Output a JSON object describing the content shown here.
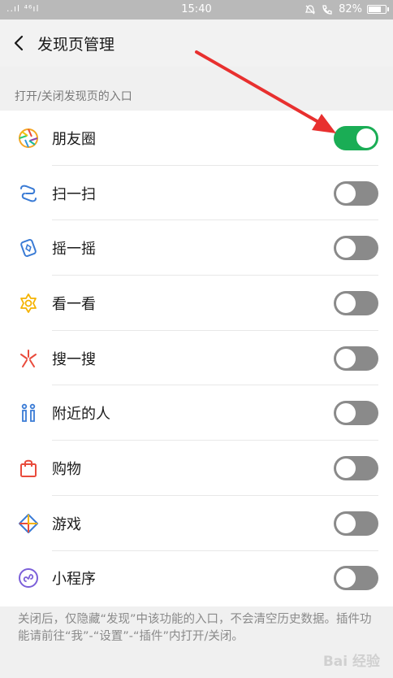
{
  "status_bar": {
    "signal": "..ıl ⁴⁶ıl",
    "time": "15:40",
    "battery_text": "82%",
    "battery_level": 0.82
  },
  "header": {
    "title": "发现页管理"
  },
  "section": {
    "label": "打开/关闭发现页的入口"
  },
  "items": [
    {
      "label": "朋友圈",
      "icon": "moments-icon",
      "enabled": true
    },
    {
      "label": "扫一扫",
      "icon": "scan-icon",
      "enabled": false
    },
    {
      "label": "摇一摇",
      "icon": "shake-icon",
      "enabled": false
    },
    {
      "label": "看一看",
      "icon": "top-stories-icon",
      "enabled": false
    },
    {
      "label": "搜一搜",
      "icon": "search-icon",
      "enabled": false
    },
    {
      "label": "附近的人",
      "icon": "people-nearby-icon",
      "enabled": false
    },
    {
      "label": "购物",
      "icon": "shopping-bag-icon",
      "enabled": false
    },
    {
      "label": "游戏",
      "icon": "games-icon",
      "enabled": false
    },
    {
      "label": "小程序",
      "icon": "mini-program-icon",
      "enabled": false
    }
  ],
  "footer": {
    "note": "关闭后，仅隐藏“发现”中该功能的入口，不会清空历史数据。插件功能请前往“我”-“设置”-“插件”内打开/关闭。"
  },
  "watermark": "Bai 经验",
  "colors": {
    "toggle_on": "#1aad55",
    "toggle_off": "#8a8a8a",
    "arrow": "#e8302f"
  }
}
